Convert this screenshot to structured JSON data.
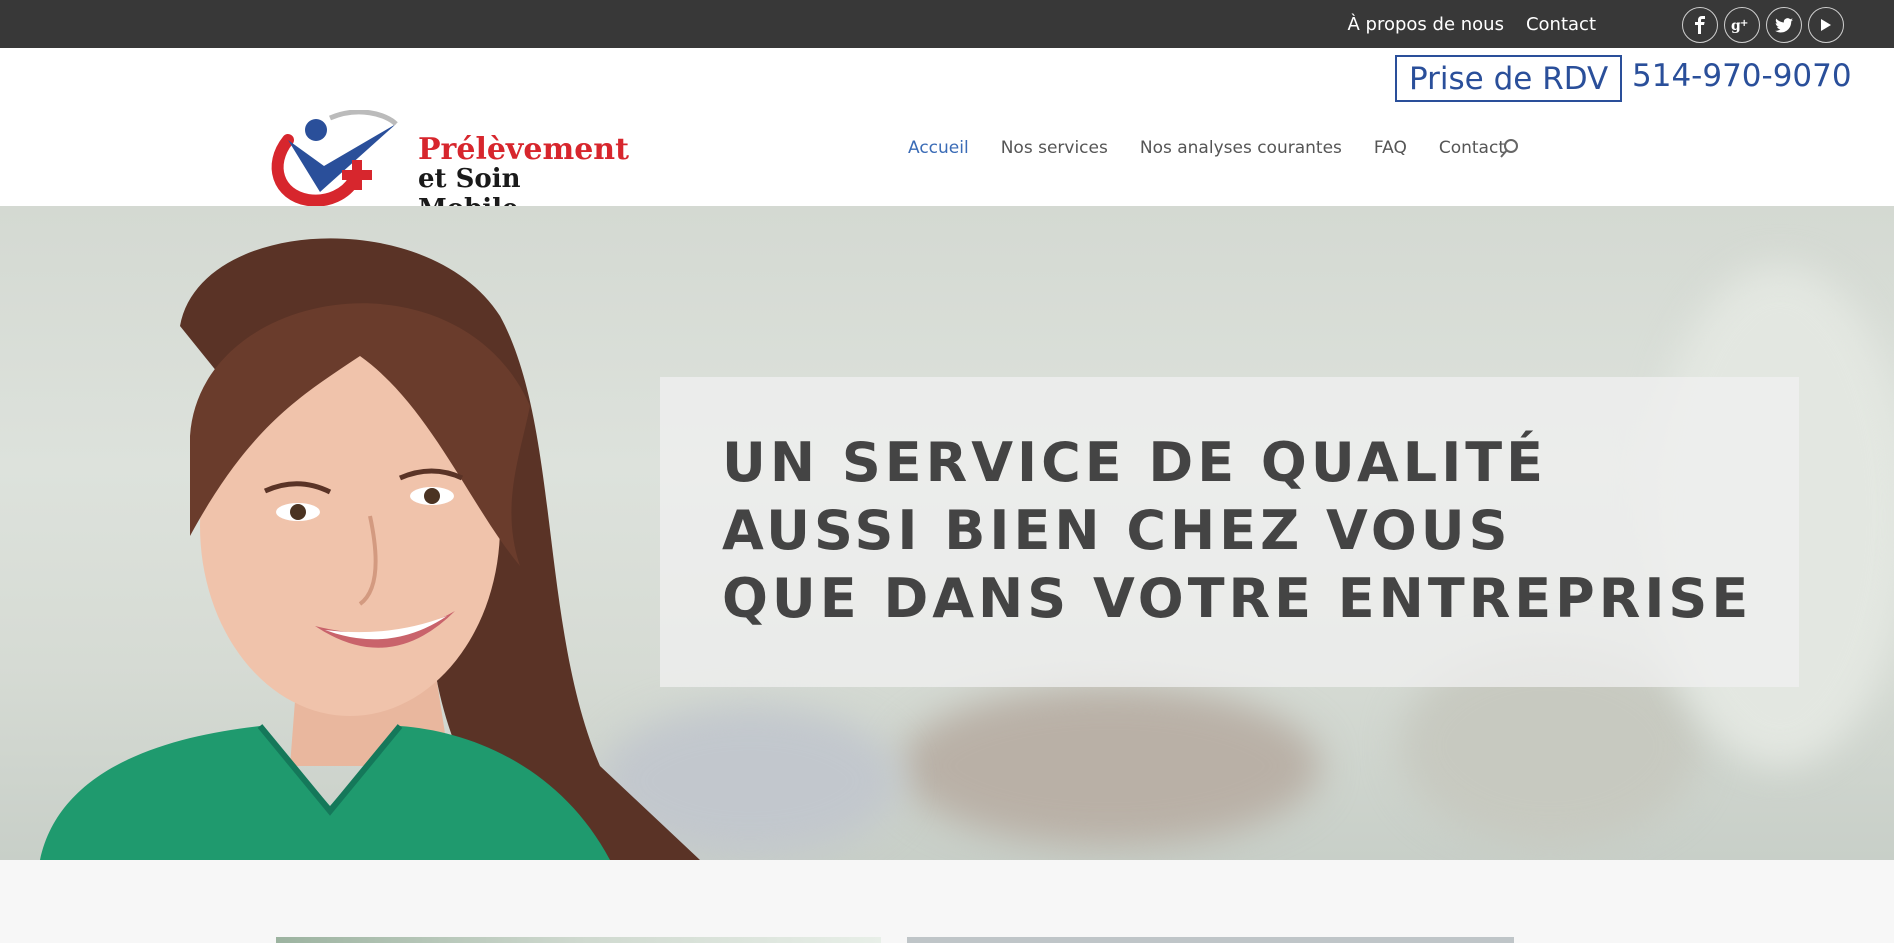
{
  "topbar": {
    "links": [
      "À propos de nous",
      "Contact"
    ],
    "social": [
      {
        "icon": "facebook-icon",
        "glyph": "f"
      },
      {
        "icon": "google-plus-icon",
        "glyph": "g+"
      },
      {
        "icon": "twitter-icon",
        "glyph": "t"
      },
      {
        "icon": "youtube-icon",
        "glyph": "▶"
      }
    ]
  },
  "header": {
    "rdv_label": "Prise de RDV",
    "phone": "514-970-9070",
    "logo": {
      "line1": "Prélèvement",
      "line2": "et Soin Mobile"
    },
    "nav": [
      "Accueil",
      "Nos services",
      "Nos analyses courantes",
      "FAQ",
      "Contact"
    ],
    "active_nav": "Accueil"
  },
  "hero": {
    "lines": [
      "UN SERVICE DE QUALITÉ",
      "AUSSI BIEN CHEZ VOUS",
      "QUE DANS VOTRE ENTREPRISE"
    ]
  },
  "colors": {
    "topbar": "#383838",
    "accent_blue": "#2a4f9a",
    "nav_active": "#3a6bb6",
    "logo_red": "#d7262d",
    "scrubs_green": "#1f9a6e"
  }
}
